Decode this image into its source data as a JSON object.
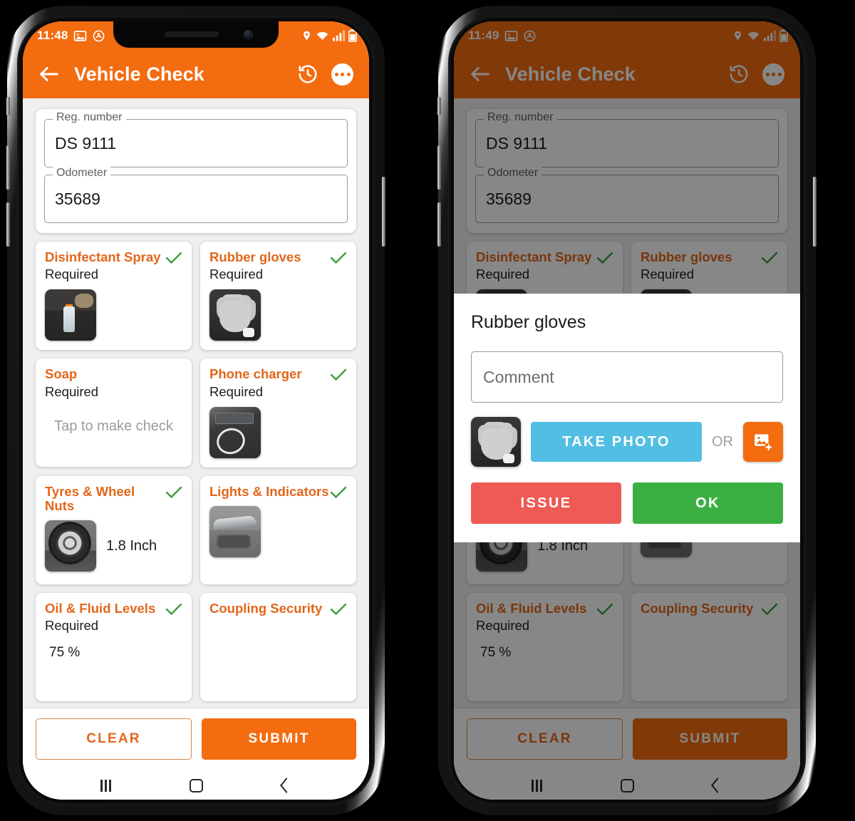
{
  "phones": [
    {
      "id": "phone-primary",
      "statusbar": {
        "time": "11:48",
        "left_icons": [
          "image-icon",
          "app-notification-icon"
        ],
        "right_icons": [
          "location-pin-icon",
          "wifi-icon",
          "signal-bars-icon",
          "battery-icon"
        ]
      },
      "appbar": {
        "title": "Vehicle Check",
        "back_icon": "arrow-left-icon",
        "history_icon": "history-icon",
        "overflow_icon": "more-vertical-icon"
      },
      "dimmed": false
    },
    {
      "id": "phone-dialog",
      "statusbar": {
        "time": "11:49",
        "left_icons": [
          "image-icon",
          "app-notification-icon"
        ],
        "right_icons": [
          "location-pin-icon",
          "wifi-icon",
          "signal-bars-icon",
          "battery-icon"
        ]
      },
      "appbar": {
        "title": "Vehicle Check",
        "back_icon": "arrow-left-icon",
        "history_icon": "history-icon",
        "overflow_icon": "more-vertical-icon"
      },
      "dimmed": true
    }
  ],
  "form": {
    "reg_number": {
      "label": "Reg. number",
      "value": "DS 9111"
    },
    "odometer": {
      "label": "Odometer",
      "value": "35689"
    }
  },
  "checks": [
    {
      "title": "Disinfectant Spray",
      "subtitle": "Required",
      "checked": true,
      "thumb": "spray-photo",
      "value": "",
      "hint": ""
    },
    {
      "title": "Rubber gloves",
      "subtitle": "Required",
      "checked": true,
      "thumb": "glove-photo",
      "value": "",
      "hint": ""
    },
    {
      "title": "Soap",
      "subtitle": "Required",
      "checked": false,
      "thumb": "",
      "value": "",
      "hint": "Tap to make check"
    },
    {
      "title": "Phone charger",
      "subtitle": "Required",
      "checked": true,
      "thumb": "charger-photo",
      "value": "",
      "hint": ""
    },
    {
      "title": "Tyres & Wheel Nuts",
      "subtitle": "",
      "checked": true,
      "thumb": "tyre-photo",
      "value": "1.8 Inch",
      "hint": ""
    },
    {
      "title": "Lights & Indicators",
      "subtitle": "",
      "checked": true,
      "thumb": "lights-photo",
      "value": "",
      "hint": ""
    },
    {
      "title": "Oil & Fluid Levels",
      "subtitle": "Required",
      "checked": true,
      "thumb": "",
      "value": "75 %",
      "hint": ""
    },
    {
      "title": "Coupling Security",
      "subtitle": "",
      "checked": true,
      "thumb": "",
      "value": "",
      "hint": ""
    }
  ],
  "actionbar": {
    "clear_label": "CLEAR",
    "submit_label": "SUBMIT"
  },
  "navbar": {
    "recents": "recents-icon",
    "home": "home-icon",
    "back": "back-icon"
  },
  "dialog": {
    "title": "Rubber gloves",
    "comment_placeholder": "Comment",
    "thumb": "glove-photo",
    "take_photo_label": "TAKE PHOTO",
    "or_label": "OR",
    "gallery_icon": "add-image-icon",
    "issue_label": "ISSUE",
    "ok_label": "OK"
  },
  "colors": {
    "brand_orange": "#F36C10",
    "title_orange": "#E2661A",
    "tick_green": "#3C9E3C",
    "take_photo_blue": "#53BEE3",
    "issue_red": "#EE5A54",
    "ok_green": "#3CAF43",
    "scrim": "rgba(0,0,0,0.47)",
    "page_bg": "#EFEFEF"
  }
}
